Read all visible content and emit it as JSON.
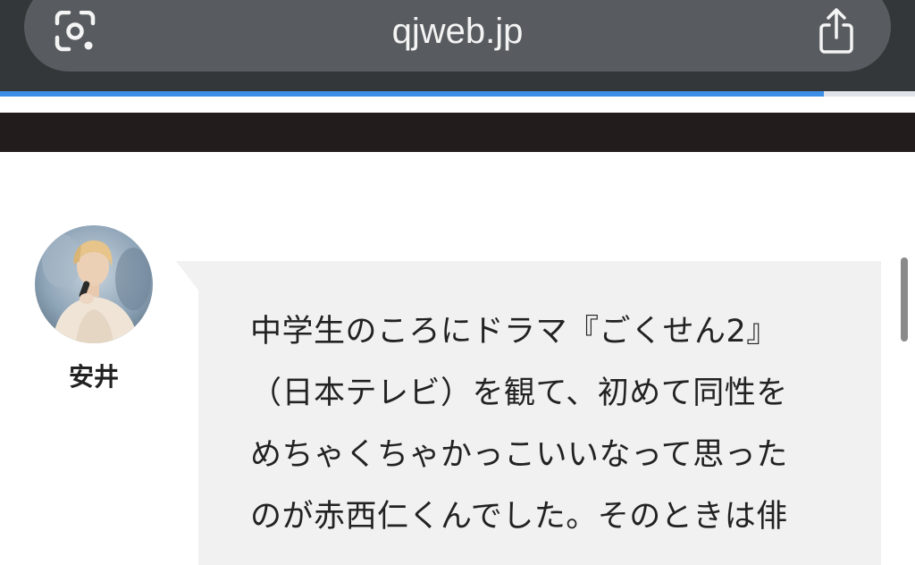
{
  "browser": {
    "url": "qjweb.jp",
    "page_load_progress": 0.9,
    "icons": {
      "left": "google-lens-icon",
      "right": "share-icon"
    }
  },
  "speaker": {
    "name": "安井",
    "avatar": "performer-with-microphone-photo"
  },
  "message": {
    "lines": [
      "中学生のころにドラマ『ごくせん2』",
      "（日本テレビ）を観て、初めて同性を",
      "めちゃくちゃかっこいいなって思った",
      "のが赤西仁くんでした。そのときは俳"
    ]
  },
  "colors": {
    "toolbar": "#343739",
    "url_pill": "#585c60",
    "progress": "#3c8ee6",
    "site_header": "#231c1c",
    "bubble": "#f1f1f1"
  }
}
